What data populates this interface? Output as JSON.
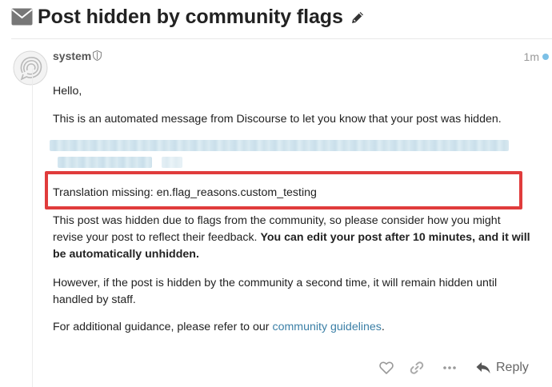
{
  "topic": {
    "title": "Post hidden by community flags"
  },
  "post": {
    "username": "system",
    "time": "1m",
    "greeting": "Hello,",
    "intro": "This is an automated message from Discourse to let you know that your post was hidden.",
    "translation_missing": "Translation missing: en.flag_reasons.custom_testing",
    "hidden_reason_plain": "This post was hidden due to flags from the community, so please consider how you might revise your post to reflect their feedback. ",
    "hidden_reason_bold": "You can edit your post after 10 minutes, and it will be automatically unhidden.",
    "however": "However, if the post is hidden by the community a second time, it will remain hidden until handled by staff.",
    "guidance_prefix": "For additional guidance, please refer to our ",
    "guidance_link": "community guidelines",
    "guidance_suffix": "."
  },
  "actions": {
    "reply_label": "Reply"
  },
  "colors": {
    "highlight_border": "#e03c3c",
    "link": "#3b7fa6",
    "new_dot": "#7cc0e6"
  },
  "icons": [
    "envelope-icon",
    "pencil-icon",
    "shield-icon",
    "heart-icon",
    "link-icon",
    "more-icon",
    "reply-icon"
  ]
}
